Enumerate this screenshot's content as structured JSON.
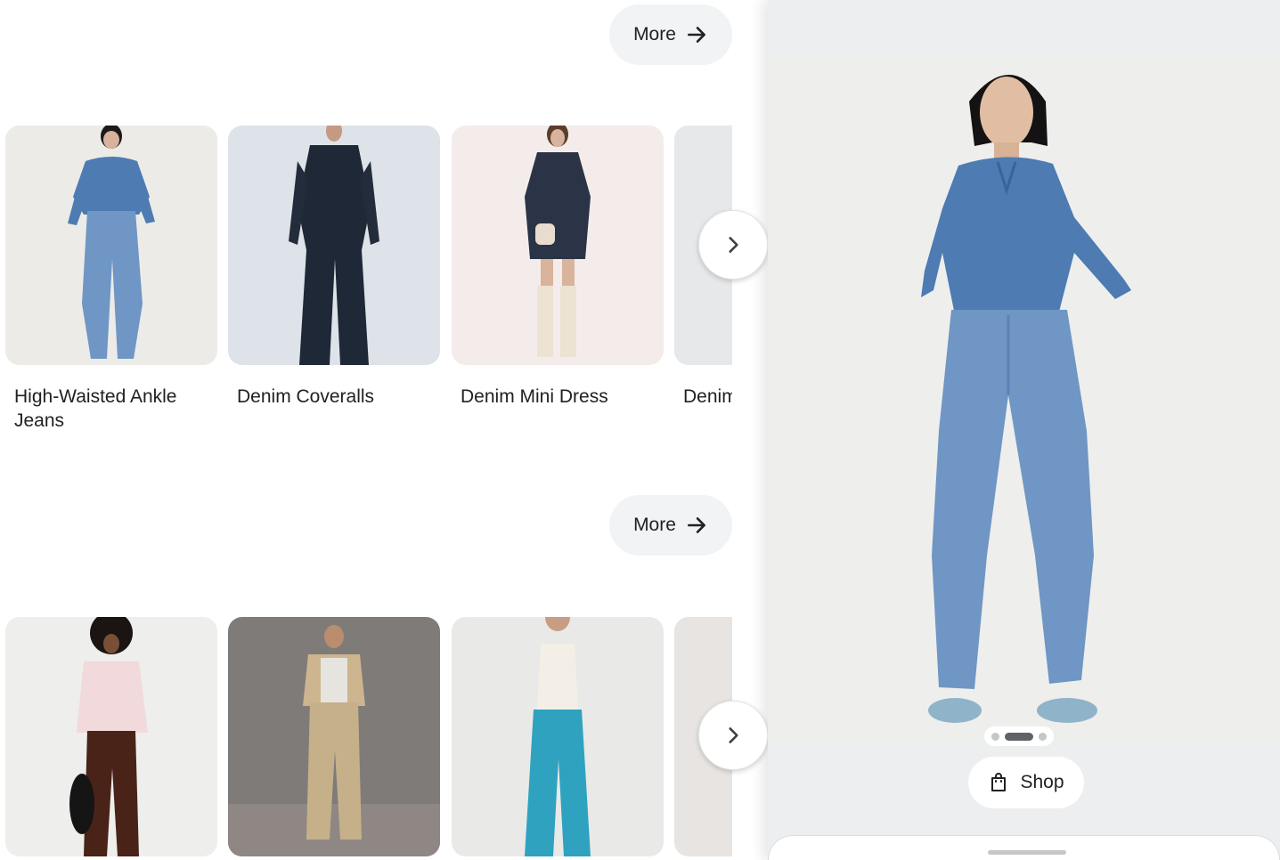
{
  "sections": [
    {
      "more_label": "More",
      "products": [
        {
          "title": "High-Waisted Ankle Jeans"
        },
        {
          "title": "Denim Coveralls"
        },
        {
          "title": "Denim Mini Dress"
        },
        {
          "title": "Denim"
        }
      ]
    },
    {
      "more_label": "More",
      "products": [
        {
          "title": ""
        },
        {
          "title": ""
        },
        {
          "title": ""
        },
        {
          "title": ""
        }
      ]
    }
  ],
  "panel": {
    "shop_label": "Shop",
    "carousel": {
      "count": 3,
      "active": 1
    }
  },
  "colors": {
    "pill_bg": "#f1f3f4",
    "panel_bg": "#eceef0",
    "denim_light": "#6f96c4",
    "denim_shirt": "#4d7bb2",
    "denim_dark": "#1f2836"
  }
}
